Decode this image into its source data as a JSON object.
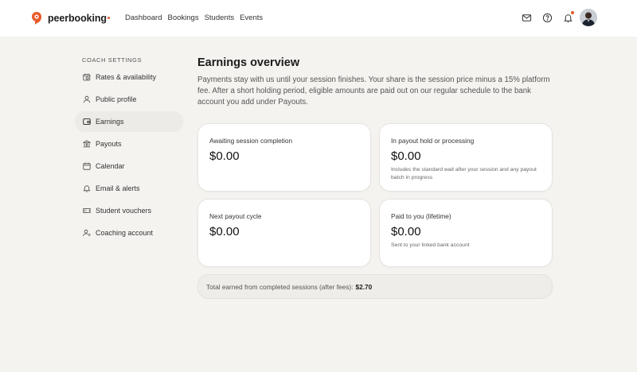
{
  "brand": {
    "name": "peerbooking",
    "accent": "#e85a2b"
  },
  "nav": {
    "items": [
      {
        "label": "Dashboard"
      },
      {
        "label": "Bookings"
      },
      {
        "label": "Students"
      },
      {
        "label": "Events"
      }
    ]
  },
  "header_icons": [
    "mail-icon",
    "help-icon",
    "bell-icon",
    "avatar"
  ],
  "sidebar": {
    "heading": "COACH SETTINGS",
    "items": [
      {
        "label": "Rates & availability",
        "icon": "calendar-clock-icon"
      },
      {
        "label": "Public profile",
        "icon": "user-icon"
      },
      {
        "label": "Earnings",
        "icon": "wallet-icon",
        "active": true
      },
      {
        "label": "Payouts",
        "icon": "bank-icon"
      },
      {
        "label": "Calendar",
        "icon": "calendar-icon"
      },
      {
        "label": "Email & alerts",
        "icon": "bell-icon"
      },
      {
        "label": "Student vouchers",
        "icon": "ticket-icon"
      },
      {
        "label": "Coaching account",
        "icon": "user-settings-icon"
      }
    ]
  },
  "main": {
    "title": "Earnings overview",
    "description": "Payments stay with us until your session finishes. Your share is the session price minus a 15% platform fee. After a short holding period, eligible amounts are paid out on our regular schedule to the bank account you add under Payouts.",
    "cards": [
      {
        "label": "Awaiting session completion",
        "value": "$0.00",
        "note": ""
      },
      {
        "label": "In payout hold or processing",
        "value": "$0.00",
        "note": "Includes the standard wait after your session and any payout batch in progress"
      },
      {
        "label": "Next payout cycle",
        "value": "$0.00",
        "note": ""
      },
      {
        "label": "Paid to you (lifetime)",
        "value": "$0.00",
        "note": "Sent to your linked bank account"
      }
    ],
    "total": {
      "label": "Total earned from completed sessions (after fees):",
      "amount": "$2.70"
    }
  }
}
